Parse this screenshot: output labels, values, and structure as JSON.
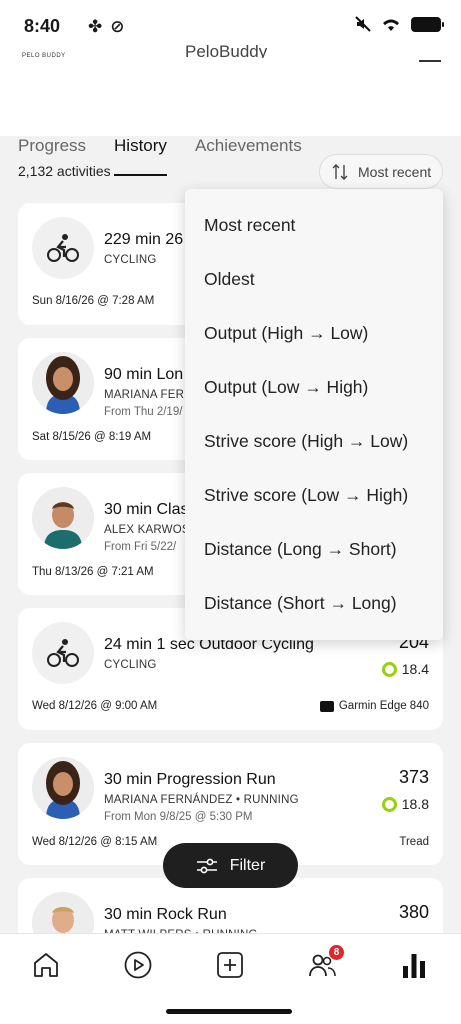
{
  "status_bar": {
    "time": "8:40"
  },
  "header": {
    "logo_text": "PELO BUDDY",
    "app_name": "PeloBuddy"
  },
  "tabs": [
    {
      "label": "Progress",
      "active": false
    },
    {
      "label": "History",
      "active": true
    },
    {
      "label": "Achievements",
      "active": false
    }
  ],
  "activities": {
    "count_label": "2,132 activities",
    "sort_label": "Most recent",
    "items": [
      {
        "title": "229 min 26",
        "type": "CYCLING",
        "from": "",
        "date": "Sun 8/16/26 @ 7:28 AM",
        "output": "",
        "score": "",
        "device": ""
      },
      {
        "title": "90 min Lon",
        "type": "MARIANA FERN",
        "from": "From Thu 2/19/",
        "date": "Sat 8/15/26 @ 8:19 AM",
        "output": "",
        "score": "",
        "device": ""
      },
      {
        "title": "30 min Clas",
        "type": "ALEX KARWOSI",
        "from": "From Fri 5/22/",
        "date": "Thu 8/13/26 @ 7:21 AM",
        "output": "",
        "score": "",
        "device": ""
      },
      {
        "title": "24 min 1 sec Outdoor Cycling",
        "type": "CYCLING",
        "from": "",
        "date": "Wed 8/12/26 @ 9:00 AM",
        "output": "204",
        "score": "18.4",
        "device": "Garmin Edge 840"
      },
      {
        "title": "30 min Progression Run",
        "type": "MARIANA FERNÁNDEZ • RUNNING",
        "from": "From Mon 9/8/25 @ 5:30 PM",
        "date": "Wed 8/12/26 @ 8:15 AM",
        "output": "373",
        "score": "18.8",
        "device": "Tread"
      },
      {
        "title": "30 min Rock Run",
        "type": "MATT WILPERS • RUNNING",
        "from": "",
        "date": "",
        "output": "380",
        "score": "",
        "device": ""
      }
    ]
  },
  "sort_menu": {
    "options": [
      "Most recent",
      "Oldest",
      "Output (High → Low)",
      "Output (Low → High)",
      "Strive score (High → Low)",
      "Strive score (Low → High)",
      "Distance (Long → Short)",
      "Distance (Short → Long)"
    ]
  },
  "filter_button": {
    "label": "Filter"
  },
  "bottom_nav": {
    "items": [
      {
        "icon": "home-icon"
      },
      {
        "icon": "play-icon"
      },
      {
        "icon": "add-icon"
      },
      {
        "icon": "community-icon",
        "badge": "8"
      },
      {
        "icon": "stats-icon"
      }
    ]
  },
  "colors": {
    "accent": "#1f1f1f",
    "strive_ring": "#9ad10e",
    "badge": "#e0262b"
  }
}
